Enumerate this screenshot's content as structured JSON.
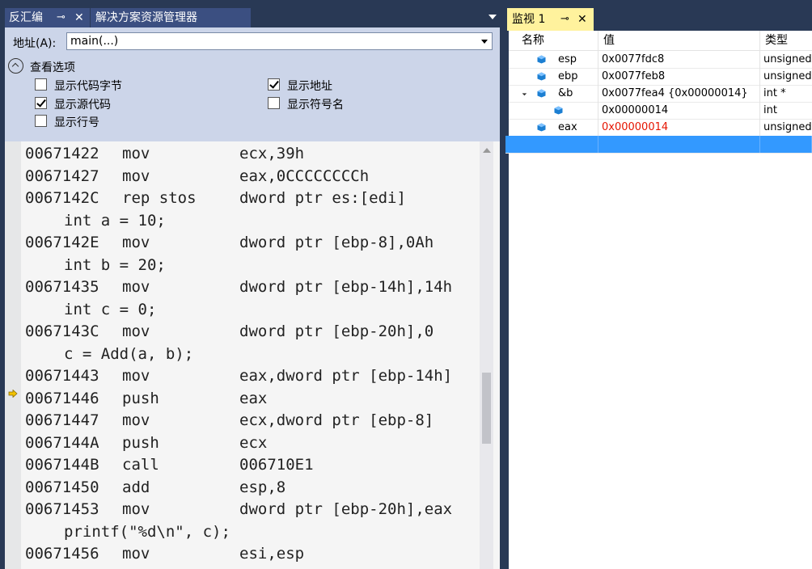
{
  "left_tabs": {
    "disassembly": "反汇编",
    "solution_explorer": "解决方案资源管理器"
  },
  "address": {
    "label": "地址(A):",
    "value": "main(...)"
  },
  "view_options": {
    "heading": "查看选项",
    "items": [
      {
        "label": "显示代码字节",
        "checked": false
      },
      {
        "label": "显示地址",
        "checked": true
      },
      {
        "label": "显示源代码",
        "checked": true
      },
      {
        "label": "显示符号名",
        "checked": false
      },
      {
        "label": "显示行号",
        "checked": false
      }
    ]
  },
  "code": [
    {
      "addr": "00671422",
      "mnemonic": "mov",
      "operands": "ecx,39h"
    },
    {
      "addr": "00671427",
      "mnemonic": "mov",
      "operands": "eax,0CCCCCCCCh"
    },
    {
      "addr": "0067142C",
      "mnemonic": "rep stos",
      "operands": "dword ptr es:[edi]"
    },
    {
      "source": "int a = 10;"
    },
    {
      "addr": "0067142E",
      "mnemonic": "mov",
      "operands": "dword ptr [ebp-8],0Ah"
    },
    {
      "source": "int b = 20;"
    },
    {
      "addr": "00671435",
      "mnemonic": "mov",
      "operands": "dword ptr [ebp-14h],14h"
    },
    {
      "source": "int c = 0;"
    },
    {
      "addr": "0067143C",
      "mnemonic": "mov",
      "operands": "dword ptr [ebp-20h],0"
    },
    {
      "source": "c = Add(a, b);"
    },
    {
      "addr": "00671443",
      "mnemonic": "mov",
      "operands": "eax,dword ptr [ebp-14h]"
    },
    {
      "addr": "00671446",
      "mnemonic": "push",
      "operands": "eax",
      "current": true
    },
    {
      "addr": "00671447",
      "mnemonic": "mov",
      "operands": "ecx,dword ptr [ebp-8]"
    },
    {
      "addr": "0067144A",
      "mnemonic": "push",
      "operands": "ecx"
    },
    {
      "addr": "0067144B",
      "mnemonic": "call",
      "operands": "006710E1"
    },
    {
      "addr": "00671450",
      "mnemonic": "add",
      "operands": "esp,8"
    },
    {
      "addr": "00671453",
      "mnemonic": "mov",
      "operands": "dword ptr [ebp-20h],eax"
    },
    {
      "source": "printf(\"%d\\n\", c);"
    },
    {
      "addr": "00671456",
      "mnemonic": "mov",
      "operands": "esi,esp"
    }
  ],
  "watch": {
    "tab_title": "监视 1",
    "columns": {
      "name": "名称",
      "value": "值",
      "type": "类型"
    },
    "rows": [
      {
        "name": "esp",
        "value": "0x0077fdc8",
        "type": "unsigned",
        "level": 0,
        "changed": false
      },
      {
        "name": "ebp",
        "value": "0x0077feb8",
        "type": "unsigned",
        "level": 0,
        "changed": false
      },
      {
        "name": "&b",
        "value": "0x0077fea4 {0x00000014}",
        "type": "int *",
        "level": 0,
        "expanded": true,
        "changed": false
      },
      {
        "name": "",
        "value": "0x00000014",
        "type": "int",
        "level": 1,
        "changed": false
      },
      {
        "name": "eax",
        "value": "0x00000014",
        "type": "unsigned",
        "level": 0,
        "changed": true
      }
    ]
  },
  "colors": {
    "changed_value": "#e51400",
    "cube_icon": "#1c7fd2",
    "selected_row": "#3399ff",
    "current_line_arrow": "#f2c200"
  }
}
